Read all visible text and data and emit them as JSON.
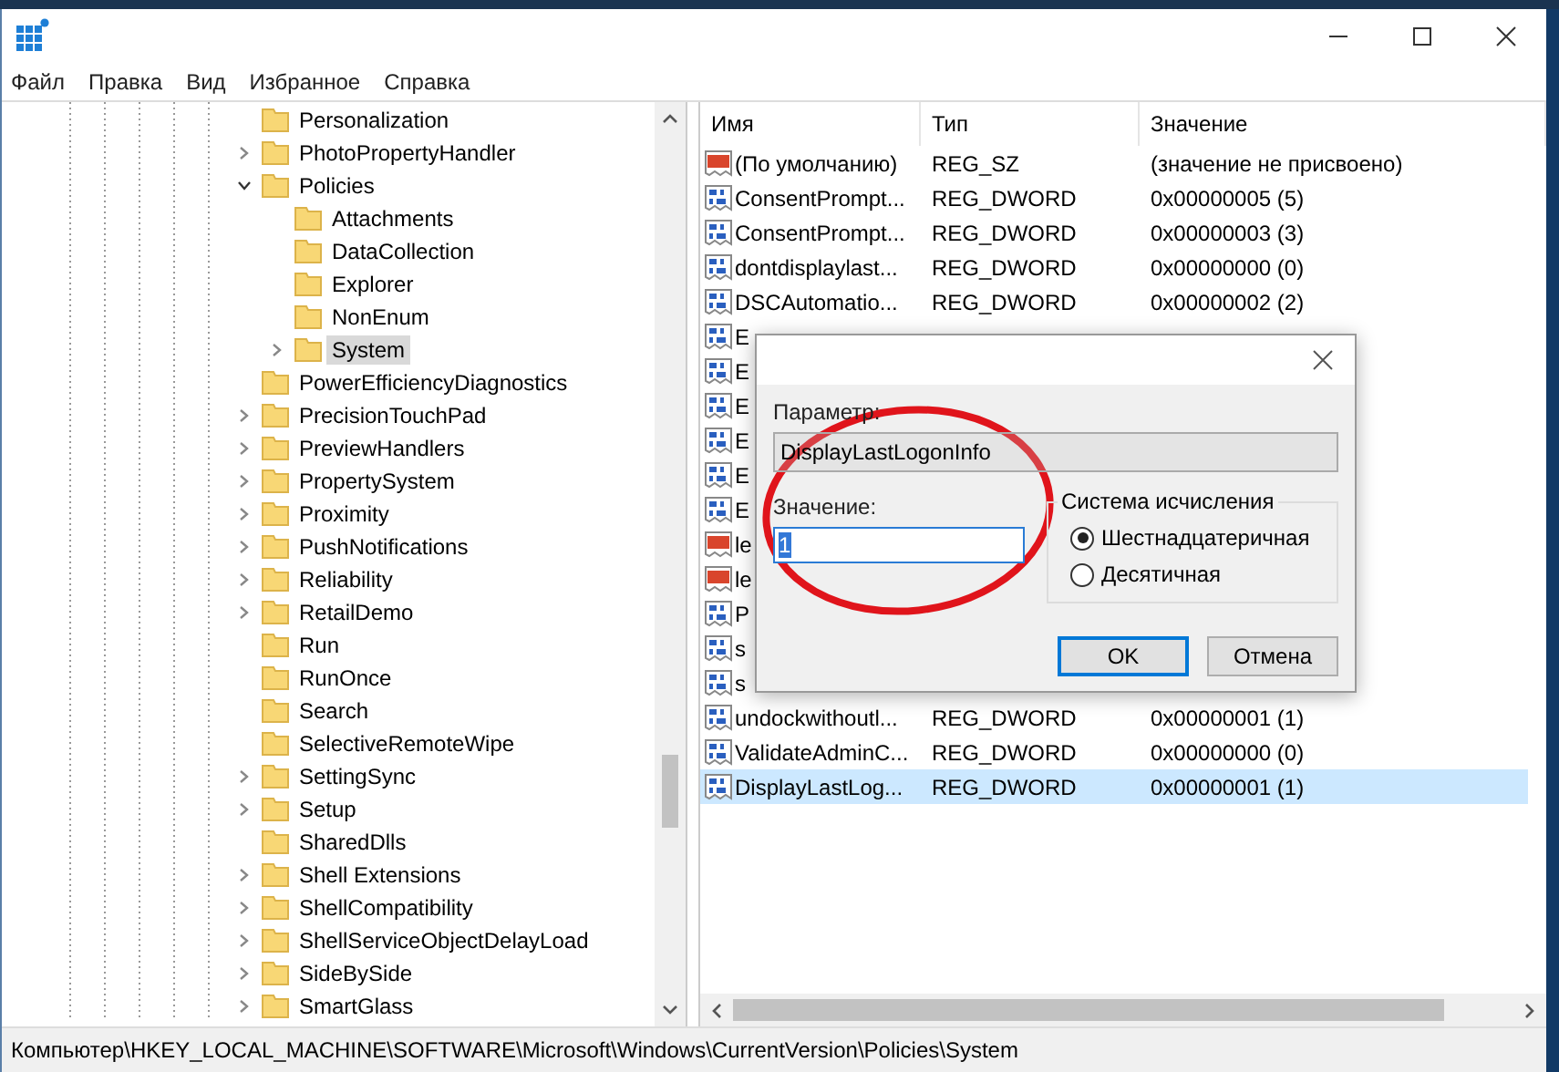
{
  "menu": [
    "Файл",
    "Правка",
    "Вид",
    "Избранное",
    "Справка"
  ],
  "tree": [
    {
      "label": "Personalization",
      "selected": false
    },
    {
      "label": "PhotoPropertyHandler",
      "expanded": false,
      "selected": false
    },
    {
      "label": "Policies",
      "expanded": true,
      "selected": false,
      "children": [
        {
          "label": "Attachments",
          "selected": false
        },
        {
          "label": "DataCollection",
          "selected": false
        },
        {
          "label": "Explorer",
          "selected": false
        },
        {
          "label": "NonEnum",
          "selected": false
        },
        {
          "label": "System",
          "expanded": false,
          "selected": true
        }
      ]
    },
    {
      "label": "PowerEfficiencyDiagnostics",
      "selected": false
    },
    {
      "label": "PrecisionTouchPad",
      "expanded": false,
      "selected": false
    },
    {
      "label": "PreviewHandlers",
      "expanded": false,
      "selected": false
    },
    {
      "label": "PropertySystem",
      "expanded": false,
      "selected": false
    },
    {
      "label": "Proximity",
      "expanded": false,
      "selected": false
    },
    {
      "label": "PushNotifications",
      "expanded": false,
      "selected": false
    },
    {
      "label": "Reliability",
      "expanded": false,
      "selected": false
    },
    {
      "label": "RetailDemo",
      "expanded": false,
      "selected": false
    },
    {
      "label": "Run",
      "selected": false
    },
    {
      "label": "RunOnce",
      "selected": false
    },
    {
      "label": "Search",
      "selected": false
    },
    {
      "label": "SelectiveRemoteWipe",
      "selected": false
    },
    {
      "label": "SettingSync",
      "expanded": false,
      "selected": false
    },
    {
      "label": "Setup",
      "expanded": false,
      "selected": false
    },
    {
      "label": "SharedDlls",
      "selected": false
    },
    {
      "label": "Shell Extensions",
      "expanded": false,
      "selected": false
    },
    {
      "label": "ShellCompatibility",
      "expanded": false,
      "selected": false
    },
    {
      "label": "ShellServiceObjectDelayLoad",
      "expanded": false,
      "selected": false
    },
    {
      "label": "SideBySide",
      "expanded": false,
      "selected": false
    },
    {
      "label": "SmartGlass",
      "expanded": false,
      "selected": false
    }
  ],
  "values": {
    "columns": [
      "Имя",
      "Тип",
      "Значение"
    ],
    "rows": [
      {
        "kind": "string",
        "name": "(По умолчанию)",
        "type": "REG_SZ",
        "value": "(значение не присвоено)",
        "selected": false
      },
      {
        "kind": "dword",
        "name": "ConsentPrompt...",
        "type": "REG_DWORD",
        "value": "0x00000005 (5)",
        "selected": false
      },
      {
        "kind": "dword",
        "name": "ConsentPrompt...",
        "type": "REG_DWORD",
        "value": "0x00000003 (3)",
        "selected": false
      },
      {
        "kind": "dword",
        "name": "dontdisplaylast...",
        "type": "REG_DWORD",
        "value": "0x00000000 (0)",
        "selected": false
      },
      {
        "kind": "dword",
        "name": "DSCAutomatio...",
        "type": "REG_DWORD",
        "value": "0x00000002 (2)",
        "selected": false
      },
      {
        "kind": "dword",
        "name": "E",
        "selected": false
      },
      {
        "kind": "dword",
        "name": "E",
        "selected": false
      },
      {
        "kind": "dword",
        "name": "E",
        "selected": false
      },
      {
        "kind": "dword",
        "name": "E",
        "selected": false
      },
      {
        "kind": "dword",
        "name": "E",
        "selected": false
      },
      {
        "kind": "dword",
        "name": "E",
        "selected": false
      },
      {
        "kind": "string",
        "name": "le",
        "selected": false
      },
      {
        "kind": "string",
        "name": "le",
        "selected": false
      },
      {
        "kind": "dword",
        "name": "P",
        "selected": false
      },
      {
        "kind": "dword",
        "name": "s",
        "selected": false
      },
      {
        "kind": "dword",
        "name": "s",
        "selected": false
      },
      {
        "kind": "dword",
        "name": "undockwithoutl...",
        "type": "REG_DWORD",
        "value": "0x00000001 (1)",
        "selected": false
      },
      {
        "kind": "dword",
        "name": "ValidateAdminC...",
        "type": "REG_DWORD",
        "value": "0x00000000 (0)",
        "selected": false
      },
      {
        "kind": "dword",
        "name": "DisplayLastLog...",
        "type": "REG_DWORD",
        "value": "0x00000001 (1)",
        "selected": true
      }
    ]
  },
  "dialog": {
    "param_label": "Параметр:",
    "param_value": "DisplayLastLogonInfo",
    "value_label": "Значение:",
    "value": "1",
    "base_group": "Система исчисления",
    "bases": [
      {
        "label": "Шестнадцатеричная",
        "selected": true
      },
      {
        "label": "Десятичная",
        "selected": false
      }
    ],
    "buttons": [
      {
        "label": "OK",
        "kind": "default"
      },
      {
        "label": "Отмена",
        "kind": "normal"
      }
    ]
  },
  "status_bar": "Компьютер\\HKEY_LOCAL_MACHINE\\SOFTWARE\\Microsoft\\Windows\\CurrentVersion\\Policies\\System"
}
